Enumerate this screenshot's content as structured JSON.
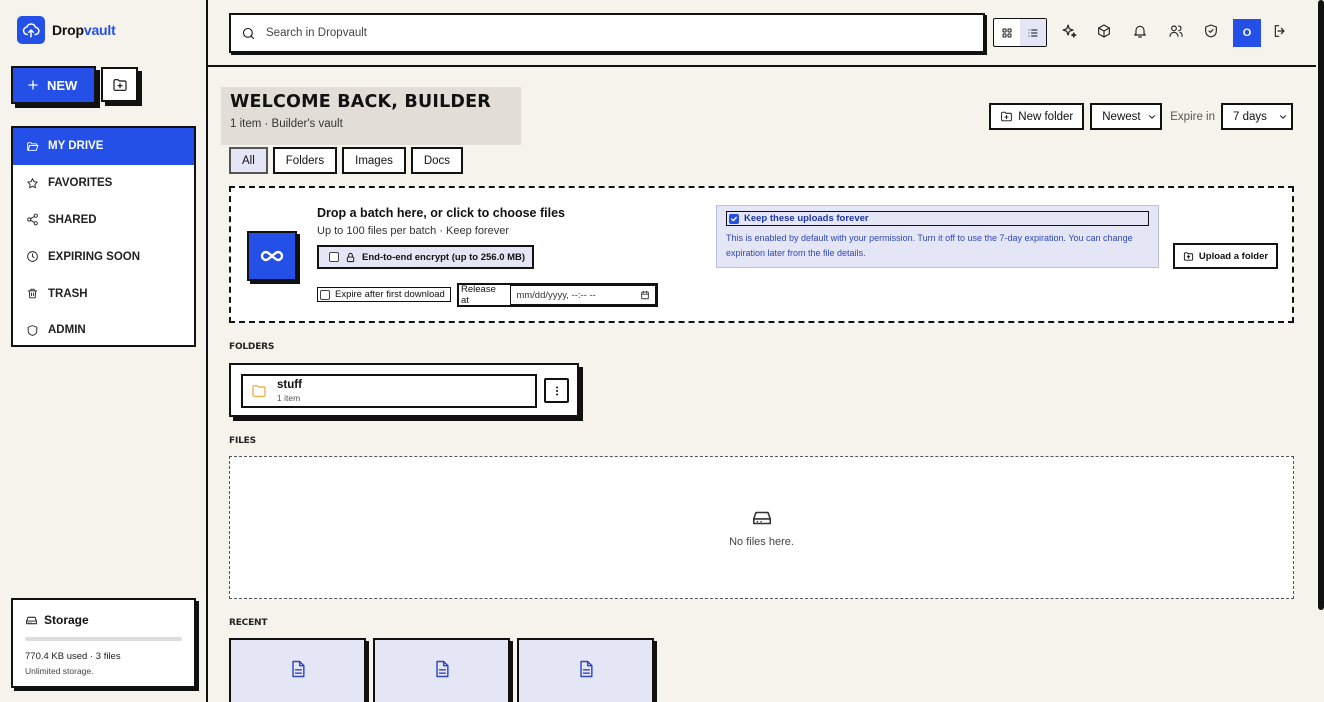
{
  "app": {
    "name_prefix": "Drop",
    "name_suffix": "vault"
  },
  "sidebar": {
    "new_label": "NEW",
    "items": [
      {
        "label": "MY DRIVE",
        "icon": "folder-open-icon",
        "active": true
      },
      {
        "label": "FAVORITES",
        "icon": "star-icon",
        "active": false
      },
      {
        "label": "SHARED",
        "icon": "share-icon",
        "active": false
      },
      {
        "label": "EXPIRING SOON",
        "icon": "clock-icon",
        "active": false
      },
      {
        "label": "TRASH",
        "icon": "trash-icon",
        "active": false
      },
      {
        "label": "ADMIN",
        "icon": "shield-icon",
        "active": false
      }
    ],
    "storage": {
      "title": "Storage",
      "used_text": "770.4 KB used · 3 files",
      "note": "Unlimited storage.",
      "used_fraction": 0
    }
  },
  "topbar": {
    "search_placeholder": "Search in Dropvault",
    "avatar_initial": "O",
    "view_mode": "list"
  },
  "header": {
    "title": "WELCOME BACK, BUILDER",
    "subtitle": "1 item · Builder's vault",
    "filters": [
      "All",
      "Folders",
      "Images",
      "Docs"
    ],
    "active_filter": "All",
    "new_folder_label": "New folder",
    "sort_value": "Newest",
    "expire_label": "Expire in",
    "expire_value": "7 days"
  },
  "upload": {
    "title": "Drop a batch here, or click to choose files",
    "subtitle": "Up to 100 files per batch · Keep forever",
    "encrypt_label": "End-to-end encrypt (up to 256.0 MB)",
    "expire_first_label": "Expire after first download",
    "release_label": "Release at",
    "release_placeholder": "mm/dd/yyyy, --:-- --",
    "keep_label": "Keep these uploads forever",
    "keep_text": "This is enabled by default with your permission. Turn it off to use the 7-day expiration. You can change expiration later from the file details.",
    "upload_folder_label": "Upload a folder"
  },
  "folders": {
    "label": "FOLDERS",
    "items": [
      {
        "name": "stuff",
        "count": "1 item"
      }
    ]
  },
  "files": {
    "label": "FILES",
    "empty_text": "No files here."
  },
  "recent": {
    "label": "RECENT",
    "count": 3
  },
  "colors": {
    "accent": "#2450e8",
    "accent_light": "#e4e6f5",
    "folder": "#f0a32a",
    "background": "#f6f3ec"
  }
}
